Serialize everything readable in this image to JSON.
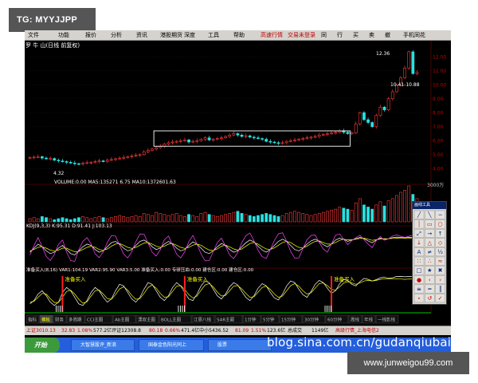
{
  "watermarks": {
    "tg": "TG: MYYJJPP",
    "url": "www.junweigou99.com",
    "blog": "blog.sina.com.cn/gudanqiubai"
  },
  "app": {
    "menu": [
      "文件",
      "功能",
      "报价",
      "分析",
      "资讯",
      "港股期货",
      "深度",
      "工具",
      "帮助",
      "高速行情",
      "交易未登录",
      "同",
      "行",
      "买",
      "卖",
      "撤",
      "手机同花"
    ],
    "chart_header": "罗 牛 山(日线 前复权)",
    "volume_label": "VOLUME:0.00  MA5:135271 6.75  MA10:1372601.63",
    "kdj_label": "KDJ(9,3,3)  K:95.31  D:91.41  J:103.13",
    "ind_label": "准备买入(8,16)  VAR1:104.19  VAR2:95.90  VAR3:5.00  准备买入:0.00  专研压血:0.00  建仓区:0.00  建仓区:0.00",
    "price_annotations": {
      "high": "12.36",
      "range": "10.41-10.88",
      "low": "4.32"
    },
    "buy_label": "准备买入",
    "vol_axis_top": "3000万",
    "status_items": [
      "上证3010.13",
      "32.83",
      "1.08%",
      "577.2亿评证12308.8",
      "80.18",
      "0.66%",
      "471.4亿中小5436.52",
      "81.09",
      "1.51%",
      "123.6亿",
      "总成交",
      "1149亿",
      "高级行情_上海电信2"
    ],
    "bottom_tabs": [
      "指标",
      "模板",
      "财务",
      "多周期",
      "CCI主图",
      "Ab主图",
      "漂双主图",
      "BOLL主图",
      "江恩八线",
      "SAR主题",
      "1分钟",
      "5分钟",
      "15分钟",
      "30分钟",
      "60分钟",
      "周线",
      "年线",
      "一线影线"
    ],
    "toolpanel_title": "画线工具",
    "taskbar": {
      "start": "开始",
      "tasks": [
        "大智慧股评_新浪",
        "国泰金色阳光同上",
        "股票"
      ]
    }
  },
  "chart_data": [
    {
      "type": "candlestick",
      "title": "罗 牛 山(日线 前复权)",
      "y_ticks": [
        12.0,
        11.0,
        10.0,
        9.0,
        8.0,
        7.0,
        6.0,
        5.0,
        4.0
      ],
      "ylim": [
        3.9,
        12.7
      ],
      "annotations": {
        "high": 12.36,
        "low": 4.32
      },
      "closes": [
        4.8,
        4.82,
        4.85,
        4.75,
        4.7,
        4.72,
        4.6,
        4.55,
        4.5,
        4.45,
        4.4,
        4.35,
        4.32,
        4.38,
        4.42,
        4.45,
        4.5,
        4.55,
        4.52,
        4.6,
        4.65,
        4.7,
        4.75,
        4.8,
        4.85,
        4.9,
        4.95,
        5.0,
        5.2,
        5.3,
        5.4,
        5.5,
        5.6,
        5.75,
        5.85,
        5.9,
        5.95,
        6.0,
        6.05,
        5.9,
        5.95,
        6.0,
        6.1,
        6.2,
        6.05,
        6.1,
        6.15,
        6.2,
        6.3,
        6.4,
        6.5,
        6.4,
        6.3,
        6.35,
        6.25,
        6.2,
        6.15,
        6.1,
        5.95,
        5.9,
        5.85,
        5.8,
        5.85,
        5.95,
        6.0,
        6.05,
        6.1,
        6.15,
        6.2,
        6.25,
        6.3,
        6.4,
        6.45,
        6.5,
        6.55,
        6.6,
        6.7,
        6.6,
        6.5,
        6.55,
        7.2,
        8.0,
        7.5,
        7.3,
        7.0,
        7.8,
        8.4,
        8.2,
        9.0,
        9.5,
        10.0,
        10.5,
        11.2,
        12.36,
        10.8,
        10.88
      ],
      "box": {
        "from": 31,
        "to": 78,
        "ylow": 5.6,
        "yhigh": 6.7
      }
    },
    {
      "type": "bar",
      "title": "VOLUME",
      "y_ticks_label": "3000万",
      "values": [
        3,
        4,
        3,
        5,
        4,
        3,
        2,
        3,
        4,
        3,
        2,
        3,
        4,
        5,
        4,
        3,
        4,
        5,
        4,
        3,
        4,
        5,
        6,
        5,
        4,
        5,
        6,
        5,
        8,
        7,
        6,
        9,
        8,
        7,
        6,
        7,
        8,
        6,
        5,
        7,
        6,
        5,
        8,
        9,
        7,
        6,
        5,
        6,
        7,
        8,
        9,
        10,
        8,
        7,
        6,
        5,
        6,
        7,
        8,
        7,
        6,
        5,
        6,
        8,
        9,
        10,
        9,
        8,
        7,
        6,
        7,
        8,
        9,
        10,
        11,
        12,
        14,
        13,
        12,
        11,
        18,
        22,
        16,
        14,
        12,
        16,
        19,
        15,
        20,
        22,
        25,
        28,
        30,
        34,
        26,
        22
      ],
      "ma5": 1352716.75,
      "ma10": 1372601.63
    },
    {
      "type": "line",
      "title": "KDJ(9,3,3)",
      "series": [
        {
          "name": "K",
          "values": [
            40,
            55,
            70,
            60,
            45,
            35,
            40,
            55,
            65,
            50,
            35,
            30,
            45,
            60,
            70,
            65,
            50,
            40,
            45,
            60,
            75,
            80,
            70,
            55,
            45,
            50,
            65,
            80,
            85,
            75,
            60,
            50,
            55,
            70,
            80,
            70,
            55,
            45,
            50,
            65,
            78,
            70,
            55,
            40,
            35,
            45,
            60,
            72,
            65,
            50,
            40,
            45,
            60,
            75,
            85,
            78,
            62,
            48,
            40,
            50,
            65,
            80,
            88,
            80,
            65,
            50,
            45,
            55,
            70,
            82,
            88,
            80,
            68,
            60,
            70,
            85,
            92,
            88,
            80,
            85,
            90,
            95,
            90,
            82,
            75,
            85,
            92,
            88,
            90,
            94,
            96,
            95,
            93,
            95,
            95.31,
            95.31
          ]
        },
        {
          "name": "D",
          "values": [
            45,
            50,
            58,
            60,
            55,
            48,
            44,
            48,
            55,
            55,
            48,
            42,
            43,
            50,
            58,
            62,
            58,
            50,
            47,
            52,
            62,
            70,
            72,
            66,
            58,
            54,
            58,
            66,
            74,
            76,
            70,
            62,
            58,
            62,
            70,
            72,
            66,
            58,
            54,
            58,
            66,
            70,
            66,
            56,
            48,
            46,
            52,
            62,
            66,
            60,
            52,
            48,
            52,
            62,
            72,
            76,
            70,
            60,
            52,
            50,
            56,
            66,
            76,
            80,
            76,
            66,
            58,
            56,
            62,
            72,
            80,
            82,
            76,
            70,
            70,
            76,
            84,
            88,
            86,
            86,
            88,
            91,
            92,
            88,
            84,
            86,
            89,
            90,
            90,
            91,
            92,
            93,
            92,
            93,
            91.41,
            91.41
          ]
        },
        {
          "name": "J",
          "values": [
            30,
            65,
            94,
            60,
            25,
            9,
            32,
            69,
            85,
            40,
            9,
            6,
            49,
            80,
            94,
            71,
            34,
            20,
            41,
            76,
            101,
            100,
            66,
            33,
            19,
            42,
            79,
            108,
            107,
            73,
            40,
            26,
            49,
            86,
            100,
            66,
            33,
            19,
            42,
            79,
            102,
            70,
            33,
            8,
            9,
            43,
            76,
            92,
            63,
            30,
            16,
            39,
            76,
            101,
            111,
            82,
            46,
            24,
            16,
            50,
            83,
            108,
            112,
            80,
            43,
            18,
            19,
            53,
            86,
            102,
            104,
            76,
            52,
            40,
            70,
            103,
            108,
            88,
            68,
            83,
            94,
            103,
            86,
            70,
            57,
            83,
            98,
            84,
            90,
            100,
            104,
            99,
            95,
            99,
            103.13,
            103.13
          ]
        }
      ]
    },
    {
      "type": "line",
      "title": "准备买入(8,16)",
      "series": [
        {
          "name": "VAR1",
          "values": [
            20,
            30,
            50,
            60,
            45,
            25,
            15,
            25,
            55,
            70,
            60,
            40,
            20,
            15,
            30,
            55,
            70,
            60,
            40,
            25,
            35,
            60,
            80,
            75,
            55,
            35,
            25,
            40,
            65,
            85,
            80,
            60,
            40,
            30,
            45,
            70,
            85,
            75,
            55,
            35,
            30,
            50,
            75,
            90,
            85,
            65,
            45,
            35,
            50,
            72,
            85,
            78,
            58,
            40,
            30,
            45,
            68,
            82,
            75,
            55,
            38,
            32,
            50,
            75,
            90,
            85,
            65,
            48,
            40,
            58,
            80,
            92,
            85,
            68,
            52,
            60,
            82,
            95,
            92,
            80,
            75,
            88,
            98,
            95,
            90,
            94,
            100,
            102,
            98,
            100,
            104,
            104.19,
            103,
            104,
            104.19,
            104.19
          ]
        },
        {
          "name": "VAR2",
          "values": [
            25,
            28,
            40,
            52,
            50,
            36,
            24,
            24,
            40,
            58,
            62,
            50,
            34,
            22,
            26,
            44,
            60,
            62,
            50,
            36,
            34,
            48,
            66,
            72,
            62,
            46,
            34,
            36,
            52,
            70,
            78,
            68,
            52,
            40,
            42,
            58,
            74,
            76,
            64,
            48,
            38,
            44,
            62,
            78,
            82,
            72,
            56,
            44,
            46,
            60,
            74,
            76,
            66,
            52,
            40,
            42,
            56,
            70,
            74,
            64,
            50,
            40,
            44,
            60,
            76,
            82,
            74,
            60,
            50,
            54,
            68,
            82,
            84,
            76,
            64,
            62,
            72,
            84,
            88,
            84,
            80,
            84,
            90,
            92,
            90,
            92,
            95,
            97,
            96,
            96,
            97,
            96,
            95,
            96,
            95.9,
            95.9
          ]
        }
      ],
      "markers": {
        "label": "准备买入",
        "at": [
          8,
          38,
          74
        ]
      }
    }
  ]
}
